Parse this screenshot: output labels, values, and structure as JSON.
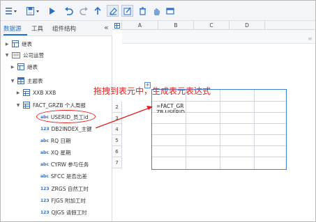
{
  "toolbar": {
    "icons": [
      "menu-icon",
      "save-icon",
      "run-icon",
      "undo-icon",
      "redo-icon",
      "return-icon",
      "eraser-icon",
      "edit-icon",
      "delete-icon",
      "hand-icon",
      "window-icon"
    ]
  },
  "left_panel": {
    "tabs": [
      "数据源",
      "工具",
      "组件结构"
    ],
    "collapse_glyph": "«",
    "tree": [
      {
        "label": "继表"
      },
      {
        "label": "公司运营"
      },
      {
        "label": "继表"
      },
      {
        "label": "主题表"
      },
      {
        "label": "XXB XXB"
      },
      {
        "label": "FACT_GRZB 个人周报"
      },
      {
        "badge": "abc",
        "label": "USERID_员工id"
      },
      {
        "badge": "123",
        "label": "DB2INDEX_主键"
      },
      {
        "badge": "abc",
        "label": "RQ 日期"
      },
      {
        "badge": "abc",
        "label": "XQ 星期"
      },
      {
        "badge": "abc",
        "label": "CYRW 参与任务"
      },
      {
        "badge": "abc",
        "label": "SFCC 是否出差"
      },
      {
        "badge": "123",
        "label": "ZRGS 自然工时"
      },
      {
        "badge": "123",
        "label": "FJGS 附加工时"
      },
      {
        "badge": "123",
        "label": "QJGS 请假工时"
      }
    ]
  },
  "grid": {
    "columns": [
      "A",
      "B",
      "C",
      "D"
    ],
    "rows": [
      "2",
      "3",
      "4",
      "5",
      "6",
      "7"
    ],
    "cell_formula": "=FACT_GR",
    "cell_formula_cont": "ZB.USERID"
  },
  "annotation": {
    "text": "拖拽到表元中，生成表元表达式",
    "color": "#e02020"
  },
  "colors": {
    "accent": "#1e73c9",
    "selection": "#3f7fd0",
    "annotation": "#e02020"
  }
}
